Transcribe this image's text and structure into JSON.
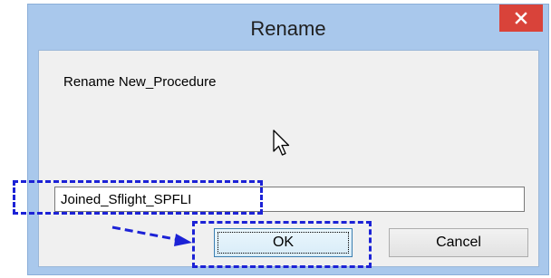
{
  "dialog": {
    "title": "Rename",
    "prompt": "Rename New_Procedure",
    "input_value": "Joined_Sflight_SPFLI",
    "ok_label": "OK",
    "cancel_label": "Cancel"
  },
  "icons": {
    "close": "close-icon",
    "cursor": "mouse-cursor-icon"
  },
  "colors": {
    "frame": "#a9c8ec",
    "close_button": "#d9433a",
    "highlight": "#1c22d6",
    "content_bg": "#f0f0f0"
  }
}
